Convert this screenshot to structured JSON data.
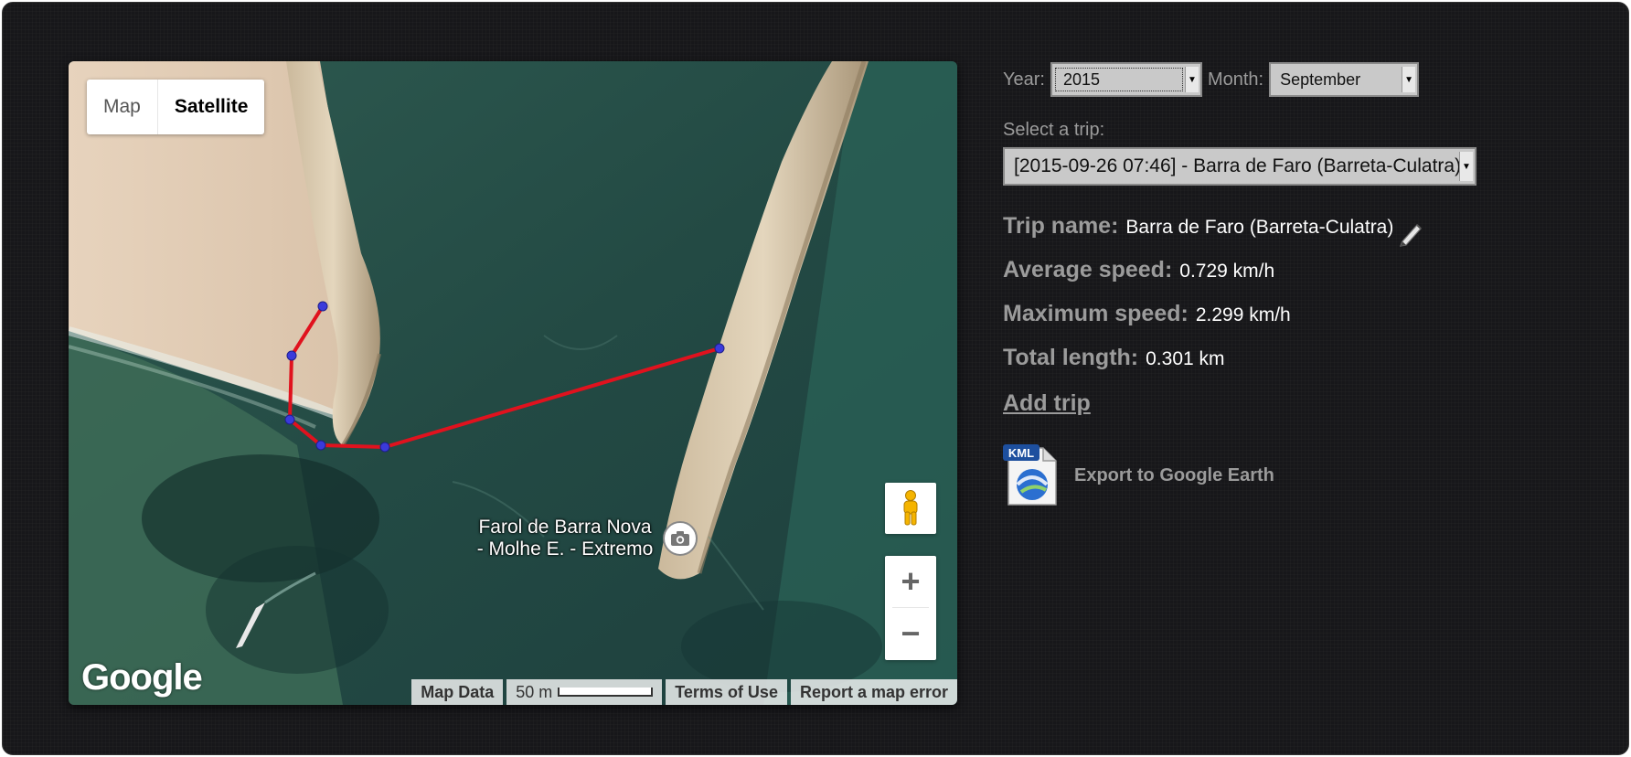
{
  "map": {
    "map_type_buttons": [
      "Map",
      "Satellite"
    ],
    "active_map_type": "Satellite",
    "logo": "Google",
    "poi_label_line1": "Farol de Barra Nova",
    "poi_label_line2": "- Molhe E. - Extremo",
    "zoom_in": "+",
    "zoom_out": "−",
    "attribution": {
      "map_data": "Map Data",
      "scale": "50 m",
      "terms": "Terms of Use",
      "report": "Report a map error"
    },
    "icons": [
      "pegman-icon",
      "camera-icon"
    ],
    "track_color": "#e0121e",
    "waypoint_color": "#3a3adb"
  },
  "filters": {
    "year_label": "Year:",
    "year_value": "2015",
    "month_label": "Month:",
    "month_value": "September"
  },
  "trip_select": {
    "label": "Select a trip:",
    "value": "[2015-09-26 07:46] - Barra de Faro (Barreta-Culatra)"
  },
  "trip_info": {
    "name_label": "Trip name:",
    "name_value": "Barra de Faro (Barreta-Culatra)",
    "avg_label": "Average speed:",
    "avg_value": "0.729 km/h",
    "max_label": "Maximum speed:",
    "max_value": "2.299 km/h",
    "length_label": "Total length:",
    "length_value": "0.301 km"
  },
  "actions": {
    "add_trip": "Add trip",
    "export": "Export to Google Earth",
    "kml_badge": "KML"
  }
}
